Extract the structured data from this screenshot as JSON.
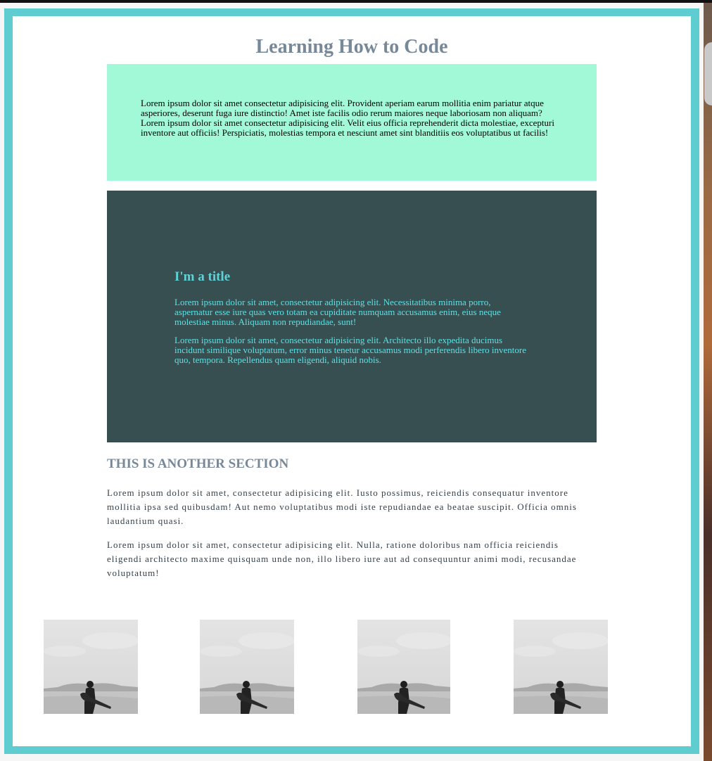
{
  "page": {
    "title": "Learning How to Code"
  },
  "intro_box": {
    "text": "Lorem ipsum dolor sit amet consectetur adipisicing elit. Provident aperiam earum mollitia enim pariatur atque asperiores, deserunt fuga iure distinctio! Amet iste facilis odio rerum maiores neque laboriosam non aliquam? Lorem ipsum dolor sit amet consectetur adipisicing elit. Velit eius officia reprehenderit dicta molestiae, excepturi inventore aut officiis! Perspiciatis, molestias tempora et nesciunt amet sint blanditiis eos voluptatibus ut facilis!"
  },
  "feature_box": {
    "title": "I'm a title",
    "paragraphs": [
      "Lorem ipsum dolor sit amet, consectetur adipisicing elit. Necessitatibus minima porro, aspernatur esse iure quas vero totam ea cupiditate numquam accusamus enim, eius neque molestiae minus. Aliquam non repudiandae, sunt!",
      "Lorem ipsum dolor sit amet, consectetur adipisicing elit. Architecto illo expedita ducimus incidunt similique voluptatum, error minus tenetur accusamus modi perferendis libero inventore quo, tempora. Repellendus quam eligendi, aliquid nobis."
    ]
  },
  "another_section": {
    "heading": "THIS IS ANOTHER SECTION",
    "paragraphs": [
      "Lorem ipsum dolor sit amet, consectetur adipisicing elit. Iusto possimus, reiciendis consequatur inventore mollitia ipsa sed quibusdam! Aut nemo voluptatibus modi iste repudiandae ea beatae suscipit. Officia omnis laudantium quasi.",
      "Lorem ipsum dolor sit amet, consectetur adipisicing elit. Nulla, ratione doloribus nam officia reiciendis eligendi architecto maxime quisquam unde non, illo libero iure aut ad consequuntur animi modi, recusandae voluptatum!"
    ]
  },
  "gallery": {
    "photos": [
      {
        "icon": "guitarist-desert-photo"
      },
      {
        "icon": "guitarist-desert-photo"
      },
      {
        "icon": "guitarist-desert-photo"
      },
      {
        "icon": "guitarist-desert-photo"
      }
    ]
  },
  "colors": {
    "frame": "#5fcdd0",
    "title": "#778899",
    "mint_box": "#a2f9d7",
    "dark_box": "#374f51",
    "dark_box_text": "#5fe0e4"
  }
}
